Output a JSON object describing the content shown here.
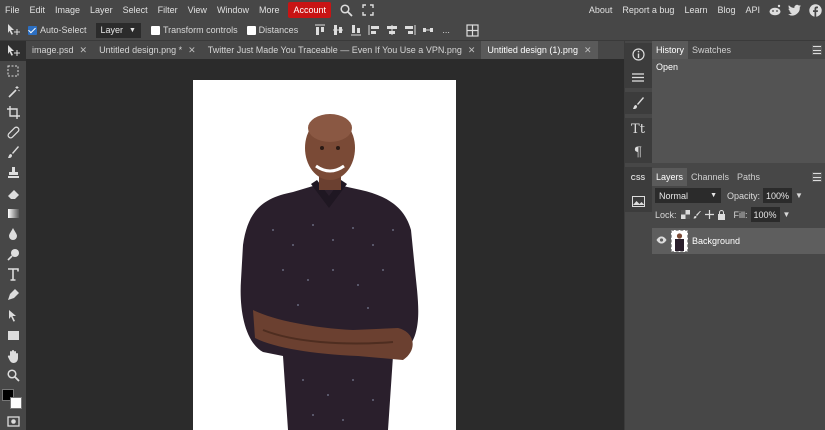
{
  "menu": {
    "items": [
      "File",
      "Edit",
      "Image",
      "Layer",
      "Select",
      "Filter",
      "View",
      "Window",
      "More"
    ],
    "account": "Account",
    "right_links": [
      "About",
      "Report a bug",
      "Learn",
      "Blog",
      "API"
    ]
  },
  "options": {
    "auto_select": "Auto-Select",
    "layer_select": "Layer",
    "transform_controls": "Transform controls",
    "distances": "Distances",
    "more": "..."
  },
  "tabs": [
    {
      "label": "image.psd",
      "close": "✕",
      "active": false
    },
    {
      "label": "Untitled design.png *",
      "close": "✕",
      "active": false
    },
    {
      "label": "Twitter Just Made You Traceable — Even If You Use a VPN.png",
      "close": "✕",
      "active": false
    },
    {
      "label": "Untitled design (1).png",
      "close": "✕",
      "active": true
    }
  ],
  "history_panel": {
    "tabs": [
      "History",
      "Swatches"
    ],
    "entries": [
      "Open"
    ]
  },
  "layers_panel": {
    "tabs": [
      "Layers",
      "Channels",
      "Paths"
    ],
    "blend_mode": "Normal",
    "opacity_label": "Opacity:",
    "opacity_value": "100%",
    "lock_label": "Lock:",
    "fill_label": "Fill:",
    "fill_value": "100%",
    "layer_name": "Background"
  },
  "narrow_panel": {
    "text_label": "Tt",
    "para_label": "¶",
    "css_label": "CSS"
  },
  "colors": {
    "accent_account": "#c81414",
    "ui_bg": "#474747",
    "workspace_bg": "#2b2b2b",
    "canvas_bg": "#ffffff",
    "foreground_swatch": "#000000",
    "background_swatch": "#ffffff"
  },
  "icons": [
    "move-tool-icon",
    "marquee-tool-icon",
    "magic-wand-icon",
    "crop-icon",
    "healing-icon",
    "brush-icon",
    "stamp-icon",
    "eraser-icon",
    "gradient-icon",
    "blur-icon",
    "dodge-icon",
    "type-tool-icon",
    "pen-icon",
    "path-select-icon",
    "rectangle-icon",
    "hand-icon",
    "zoom-icon"
  ]
}
